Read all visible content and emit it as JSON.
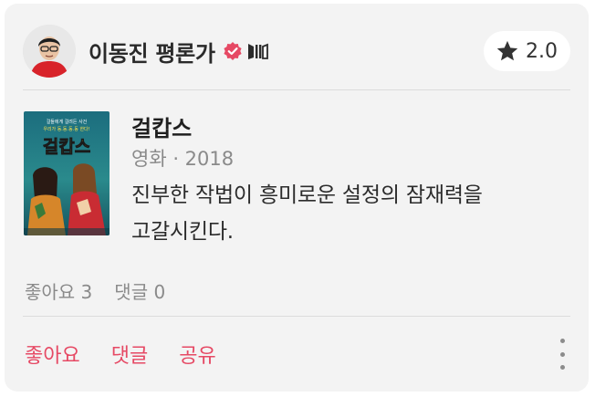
{
  "header": {
    "author_name": "이동진 평론가",
    "rating": "2.0",
    "icons": {
      "avatar": "avatar",
      "verified": "verified-badge-icon",
      "critic": "critic-badge-icon",
      "rating": "star-icon"
    }
  },
  "content": {
    "title": "걸캅스",
    "meta": "영화 · 2018",
    "review_lines": [
      "진부한 작법이 흥미로운 설정의 잠재력을",
      "고갈시킨다."
    ],
    "poster": {
      "title": "걸캅스",
      "tagline_line1": "걸들에게 걸려든 사건",
      "tagline_line2": "우리가 동.동.동.동 한다!"
    }
  },
  "stats": {
    "likes": "좋아요 3",
    "comments": "댓글 0"
  },
  "actions": {
    "like_label": "좋아요",
    "comment_label": "댓글",
    "share_label": "공유",
    "more_icon": "more-vertical-icon"
  },
  "colors": {
    "accent": "#e64964",
    "card_bg": "#f3f3f3",
    "muted_text": "#8a8a8a",
    "verified": "#e64964"
  }
}
